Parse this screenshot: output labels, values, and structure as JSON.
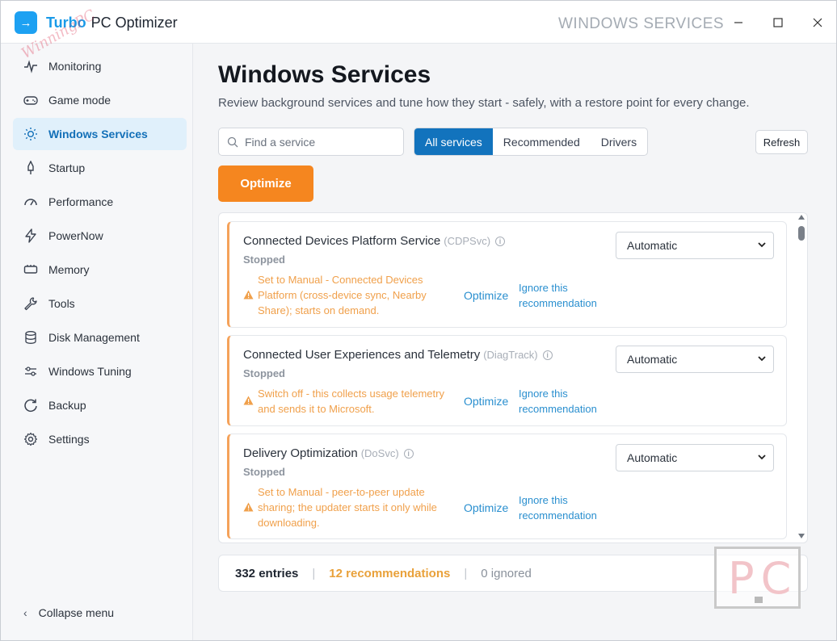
{
  "titlebar": {
    "logo_glyph": "→",
    "brand": "Turbo",
    "app_name": "PC Optimizer",
    "section": "WINDOWS SERVICES",
    "minimize": "—",
    "maximize": "☐",
    "close": "✕"
  },
  "sidebar": {
    "items": [
      {
        "label": "Monitoring",
        "icon": "pulse-icon"
      },
      {
        "label": "Game mode",
        "icon": "gamepad-icon"
      },
      {
        "label": "Windows Services",
        "icon": "sun-icon",
        "active": true
      },
      {
        "label": "Startup",
        "icon": "rocket-icon"
      },
      {
        "label": "Performance",
        "icon": "gauge-icon"
      },
      {
        "label": "PowerNow",
        "icon": "bolt-icon"
      },
      {
        "label": "Memory",
        "icon": "memory-icon"
      },
      {
        "label": "Tools",
        "icon": "wrench-icon"
      },
      {
        "label": "Disk Management",
        "icon": "database-icon"
      },
      {
        "label": "Windows Tuning",
        "icon": "sliders-icon"
      },
      {
        "label": "Backup",
        "icon": "backup-icon"
      },
      {
        "label": "Settings",
        "icon": "gear-icon"
      }
    ],
    "collapse_label": "Collapse menu",
    "watermark": "WinningPC"
  },
  "main": {
    "title": "Windows Services",
    "subtitle": "Review background services and tune how they start - safely, with a restore point for every change.",
    "search_placeholder": "Find a service",
    "filters": [
      {
        "label": "All services",
        "active": true
      },
      {
        "label": "Recommended",
        "active": false
      },
      {
        "label": "Drivers",
        "active": false
      }
    ],
    "refresh_label": "Refresh",
    "optimize_label": "Optimize",
    "services": [
      {
        "name": "Connected Devices Platform Service",
        "code": "(CDPSvc)",
        "status": "Stopped",
        "recommendation": "Set to Manual - Connected Devices Platform (cross-device sync, Nearby Share); starts on demand.",
        "optimize": "Optimize",
        "ignore": "Ignore this recommendation",
        "startup_type": "Automatic"
      },
      {
        "name": "Connected User Experiences and Telemetry",
        "code": "(DiagTrack)",
        "status": "Stopped",
        "recommendation": "Switch off - this collects usage telemetry and sends it to Microsoft.",
        "optimize": "Optimize",
        "ignore": "Ignore this recommendation",
        "startup_type": "Automatic"
      },
      {
        "name": "Delivery Optimization",
        "code": "(DoSvc)",
        "status": "Stopped",
        "recommendation": "Set to Manual - peer-to-peer update sharing; the updater starts it only while downloading.",
        "optimize": "Optimize",
        "ignore": "Ignore this recommendation",
        "startup_type": "Automatic"
      }
    ],
    "footer": {
      "entries": "332 entries",
      "recommendations": "12 recommendations",
      "ignored": "0 ignored",
      "separator": "|"
    }
  },
  "watermark_pc": "PC",
  "colors": {
    "accent": "#1273bd",
    "brand": "#1a9ae8",
    "optimize": "#f5861f",
    "warning": "#f0a04b",
    "link": "#2a8fcf"
  }
}
